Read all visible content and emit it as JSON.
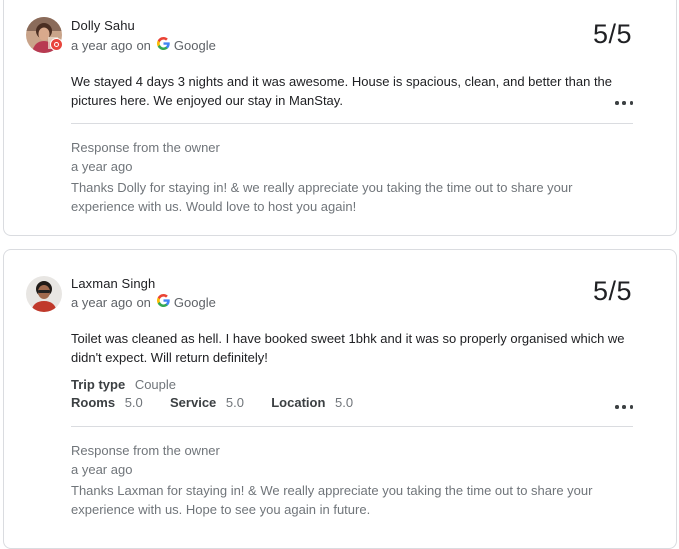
{
  "reviews": [
    {
      "reviewer": "Dolly Sahu",
      "time": "a year ago",
      "on_label": "on",
      "source": "Google",
      "score": "5/5",
      "text": "We stayed 4 days 3 nights and it was awesome. House is spacious, clean, and better than the pictures here. We enjoyed our stay in ManStay.",
      "response_title": "Response from the owner",
      "response_time": "a year ago",
      "response_text": "Thanks Dolly for staying in! & we really appreciate you taking the time out to share your experience with us. Would love to host you again!",
      "more_icon": "more-horiz-icon",
      "avatar_badge_color": "#e8453c"
    },
    {
      "reviewer": "Laxman Singh",
      "time": "a year ago",
      "on_label": "on",
      "source": "Google",
      "score": "5/5",
      "text": "Toilet was cleaned as hell. I have booked sweet 1bhk and it was so properly organised which we didn't expect. Will return definitely!",
      "trip_type_label": "Trip type",
      "trip_type_value": "Couple",
      "ratings": [
        {
          "label": "Rooms",
          "value": "5.0"
        },
        {
          "label": "Service",
          "value": "5.0"
        },
        {
          "label": "Location",
          "value": "5.0"
        }
      ],
      "response_title": "Response from the owner",
      "response_time": "a year ago",
      "response_text": "Thanks Laxman for staying in! & We really appreciate you taking the time out to share your experience with us. Hope to see you again in future.",
      "more_icon": "more-horiz-icon"
    }
  ],
  "colors": {
    "google_blue": "#4285f4",
    "google_red": "#ea4335",
    "google_yellow": "#fbbc05",
    "google_green": "#34a853"
  }
}
